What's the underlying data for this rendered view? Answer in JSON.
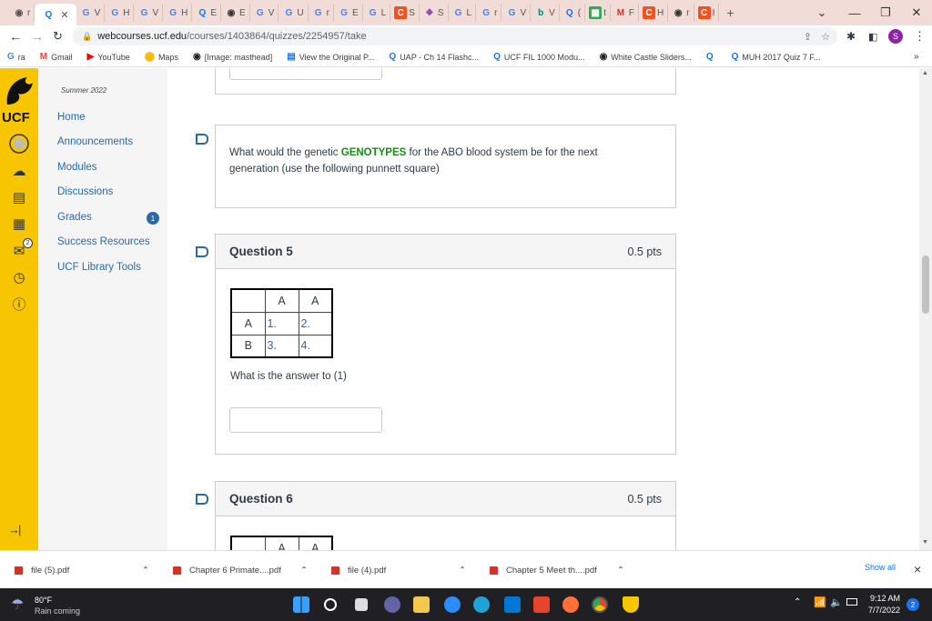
{
  "browser": {
    "active_tab_letter": "Q",
    "url_host": "webcourses.ucf.edu",
    "url_path": "/courses/1403864/quizzes/2254957/take",
    "new_tab_symbol": "+",
    "profile_initial": "S"
  },
  "bookmarks": [
    {
      "label": "ra",
      "icon": "G",
      "color": "#4285f4"
    },
    {
      "label": "Gmail",
      "icon": "M",
      "color": "#ea4335"
    },
    {
      "label": "YouTube",
      "icon": "▶",
      "color": "#ff0000"
    },
    {
      "label": "Maps",
      "icon": "⬤",
      "color": "#fbbc04"
    },
    {
      "label": "[Image: masthead]",
      "icon": "◉",
      "color": "#222"
    },
    {
      "label": "View the Original P...",
      "icon": "▤",
      "color": "#1a73e8"
    },
    {
      "label": "UAP - Ch 14 Flashc...",
      "icon": "Q",
      "color": "#1a73e8"
    },
    {
      "label": "UCF FIL 1000 Modu...",
      "icon": "Q",
      "color": "#1a73e8"
    },
    {
      "label": "White Castle Sliders...",
      "icon": "◉",
      "color": "#222"
    },
    {
      "label": "",
      "icon": "Q",
      "color": "#1a73e8"
    },
    {
      "label": "MUH 2017 Quiz 7 F...",
      "icon": "Q",
      "color": "#1a73e8"
    }
  ],
  "canvas": {
    "logo_text": "UCF",
    "term": "Summer 2022",
    "nav": [
      "Home",
      "Announcements",
      "Modules",
      "Discussions",
      "Grades",
      "Success Resources",
      "UCF Library Tools"
    ],
    "grades_badge": "1",
    "inbox_badge": "2",
    "collapse_icon": "→|"
  },
  "quiz": {
    "prev_text_before": "What would the genetic ",
    "prev_text_highlight": "GENOTYPES",
    "prev_text_after": " for the ABO blood system be for the next generation (use the following punnett square)",
    "q5": {
      "title": "Question 5",
      "points": "0.5 pts",
      "headers": [
        "A",
        "A"
      ],
      "rows": [
        {
          "label": "A",
          "cells": [
            "1.",
            "2."
          ]
        },
        {
          "label": "B",
          "cells": [
            "3.",
            "4."
          ]
        }
      ],
      "prompt": "What is the answer to (1)"
    },
    "q6": {
      "title": "Question 6",
      "points": "0.5 pts",
      "headers": [
        "A",
        "A"
      ]
    }
  },
  "downloads": {
    "files": [
      "file (5).pdf",
      "Chapter 6 Primate....pdf",
      "file (4).pdf",
      "Chapter 5 Meet th....pdf"
    ],
    "show_all": "Show all",
    "close": "×"
  },
  "taskbar": {
    "temp": "80°F",
    "weather": "Rain coming",
    "time": "9:12 AM",
    "date": "7/7/2022",
    "notif": "2"
  }
}
